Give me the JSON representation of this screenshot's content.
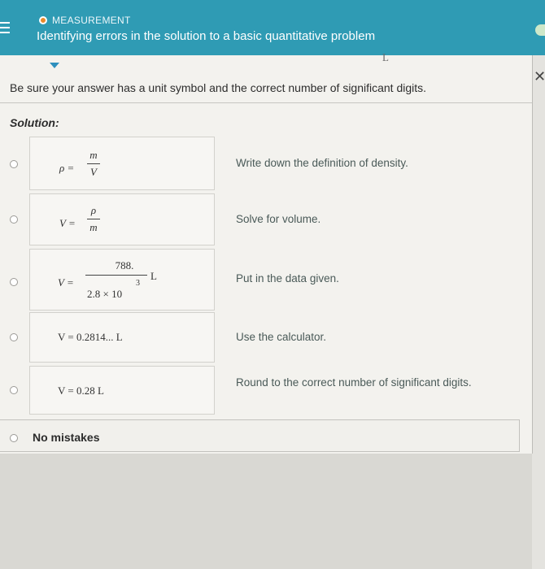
{
  "header": {
    "topic": "MEASUREMENT",
    "title": "Identifying errors in the solution to a basic quantitative problem",
    "bg": "#2f9bb4",
    "topic_dot_color": "#ea8a2a"
  },
  "panel": {
    "ghost_unit": "L",
    "instruction": "Be sure your answer has a unit symbol and the correct number of significant digits.",
    "solution_label": "Solution:",
    "close_icon": "close-x-icon"
  },
  "steps": [
    {
      "lhs": "ρ =",
      "num": "m",
      "den": "V",
      "comment": "Write down the definition of density."
    },
    {
      "lhs": "V =",
      "num": "ρ",
      "den": "m",
      "comment": "Solve for volume."
    },
    {
      "lhs": "V =",
      "num": "788.",
      "den_base": "2.8 × 10",
      "den_exp": "3",
      "unit": "L",
      "comment": "Put in the data given."
    },
    {
      "expr": "V = 0.2814... L",
      "comment": "Use the calculator."
    },
    {
      "expr": "V = 0.28 L",
      "comment": "Round to the correct number of significant digits."
    }
  ],
  "no_mistakes": "No mistakes"
}
